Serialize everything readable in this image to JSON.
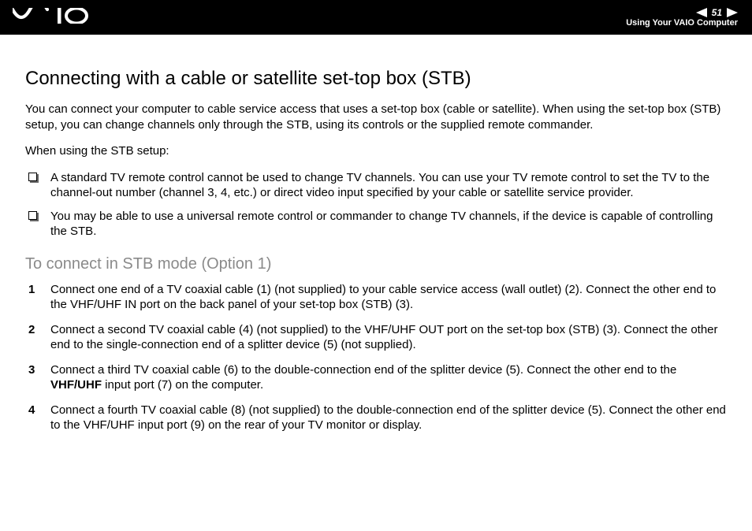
{
  "header": {
    "page_number": "51",
    "section": "Using Your VAIO Computer"
  },
  "title": "Connecting with a cable or satellite set-top box (STB)",
  "intro": "You can connect your computer to cable service access that uses a set-top box (cable or satellite). When using the set-top box (STB) setup, you can change channels only through the STB, using its controls or the supplied remote commander.",
  "when_using": "When using the STB setup:",
  "bullets": [
    "A standard TV remote control cannot be used to change TV channels. You can use your TV remote control to set the TV to the channel-out number (channel 3, 4, etc.) or direct video input specified by your cable or satellite service provider.",
    "You may be able to use a universal remote control or commander to change TV channels, if the device is capable of controlling the STB."
  ],
  "subheading": "To connect in STB mode (Option 1)",
  "steps": [
    {
      "num": "1",
      "text_a": "Connect one end of a TV coaxial cable (1) (not supplied) to your cable service access (wall outlet) (2). Connect the other end to the VHF/UHF IN port on the back panel of your set-top box (STB) (3)."
    },
    {
      "num": "2",
      "text_a": "Connect a second TV coaxial cable (4) (not supplied) to the VHF/UHF OUT port on the set-top box (STB) (3). Connect the other end to the single-connection end of a splitter device (5) (not supplied)."
    },
    {
      "num": "3",
      "text_a": "Connect a third TV coaxial cable (6) to the double-connection end of the splitter device (5). Connect the other end to the ",
      "bold": "VHF/UHF",
      "text_b": " input port (7) on the computer."
    },
    {
      "num": "4",
      "text_a": "Connect a fourth TV coaxial cable (8) (not supplied) to the double-connection end of the splitter device (5). Connect the other end to the VHF/UHF input port (9) on the rear of your TV monitor or display."
    }
  ]
}
